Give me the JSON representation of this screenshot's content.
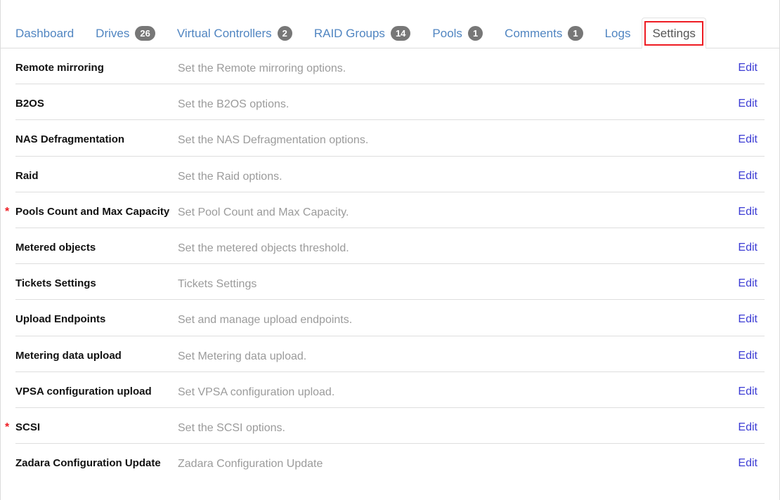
{
  "nav": {
    "tabs": [
      {
        "label": "Dashboard",
        "badge": null,
        "active": false
      },
      {
        "label": "Drives",
        "badge": "26",
        "active": false
      },
      {
        "label": "Virtual Controllers",
        "badge": "2",
        "active": false
      },
      {
        "label": "RAID Groups",
        "badge": "14",
        "active": false
      },
      {
        "label": "Pools",
        "badge": "1",
        "active": false
      },
      {
        "label": "Comments",
        "badge": "1",
        "active": false
      },
      {
        "label": "Logs",
        "badge": null,
        "active": false
      },
      {
        "label": "Settings",
        "badge": null,
        "active": true
      }
    ],
    "active_tab_highlight_color": "#ee1c23",
    "link_color": "#5085c1",
    "badge_color": "#777777"
  },
  "settings": {
    "edit_label": "Edit",
    "required_marker": "*",
    "required_marker_color": "#ee1c23",
    "rows": [
      {
        "name": "Remote mirroring",
        "description": "Set the Remote mirroring options.",
        "required": false
      },
      {
        "name": "B2OS",
        "description": "Set the B2OS options.",
        "required": false
      },
      {
        "name": "NAS Defragmentation",
        "description": "Set the NAS Defragmentation options.",
        "required": false
      },
      {
        "name": "Raid",
        "description": "Set the Raid options.",
        "required": false
      },
      {
        "name": "Pools Count and Max Capacity",
        "description": "Set Pool Count and Max Capacity.",
        "required": true
      },
      {
        "name": "Metered objects",
        "description": "Set the metered objects threshold.",
        "required": false
      },
      {
        "name": "Tickets Settings",
        "description": "Tickets Settings",
        "required": false
      },
      {
        "name": "Upload Endpoints",
        "description": "Set and manage upload endpoints.",
        "required": false
      },
      {
        "name": "Metering data upload",
        "description": "Set Metering data upload.",
        "required": false
      },
      {
        "name": "VPSA configuration upload",
        "description": "Set VPSA configuration upload.",
        "required": false
      },
      {
        "name": "SCSI",
        "description": "Set the SCSI options.",
        "required": true
      },
      {
        "name": "Zadara Configuration Update",
        "description": "Zadara Configuration Update",
        "required": false
      }
    ]
  }
}
